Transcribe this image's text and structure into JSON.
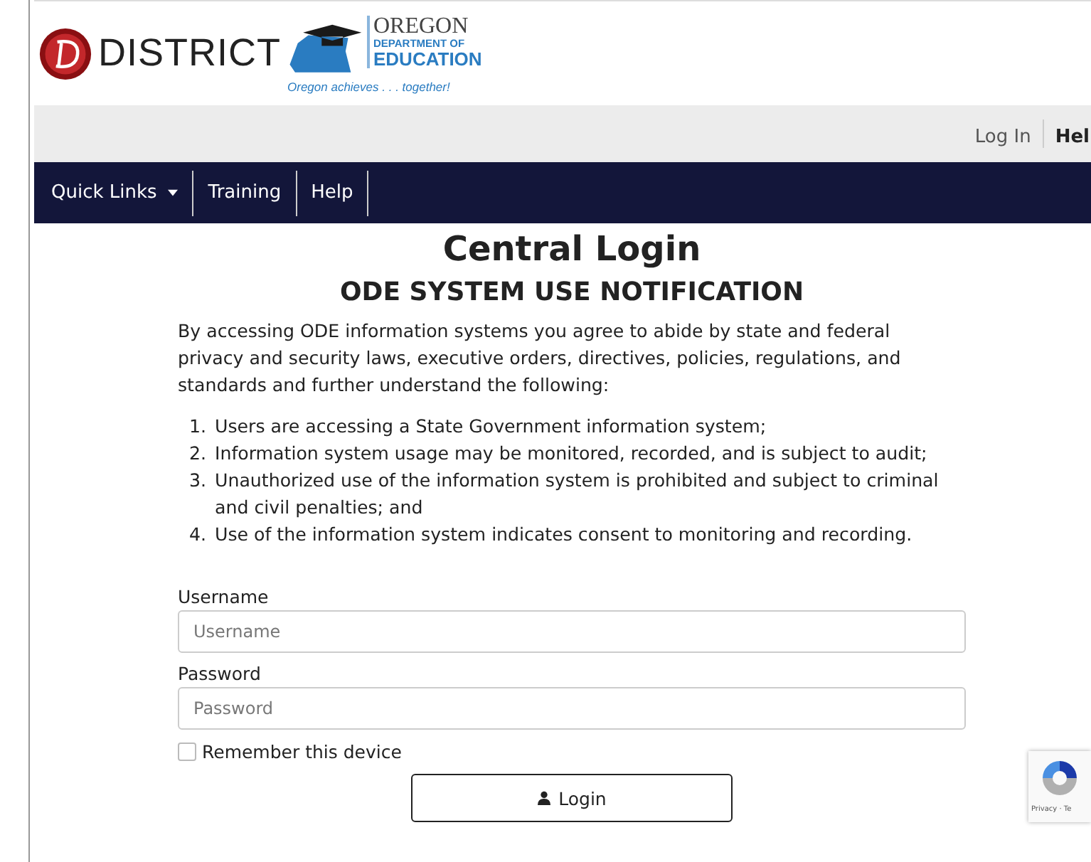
{
  "logo": {
    "brand": "DISTRICT",
    "agency_name": "OREGON",
    "agency_line": "DEPARTMENT OF",
    "agency_dept": "EDUCATION",
    "tagline": "Oregon achieves . . . together!"
  },
  "top_links": {
    "login": "Log In",
    "help": "Hel"
  },
  "nav": [
    {
      "label": "Quick Links",
      "dropdown": true
    },
    {
      "label": "Training",
      "dropdown": false
    },
    {
      "label": "Help",
      "dropdown": false
    }
  ],
  "title": "Central Login",
  "notice": {
    "heading": "ODE SYSTEM USE NOTIFICATION",
    "intro": "By accessing ODE information systems you agree to abide by state and federal privacy and security laws, executive orders, directives, policies, regulations, and standards and further understand the following:",
    "items": [
      "Users are accessing a State Government information system;",
      "Information system usage may be monitored, recorded, and is subject to audit;",
      "Unauthorized use of the information system is prohibited and subject to criminal and civil penalties; and",
      "Use of the information system indicates consent to monitoring and recording."
    ],
    "markers": [
      "1.",
      "2.",
      "3.",
      "4."
    ]
  },
  "form": {
    "username": {
      "label": "Username",
      "placeholder": "Username"
    },
    "password": {
      "label": "Password",
      "placeholder": "Password"
    },
    "remember": {
      "label": "Remember this device",
      "checked": false
    },
    "submit": "Login"
  },
  "captcha": {
    "links": "Privacy · Te"
  }
}
